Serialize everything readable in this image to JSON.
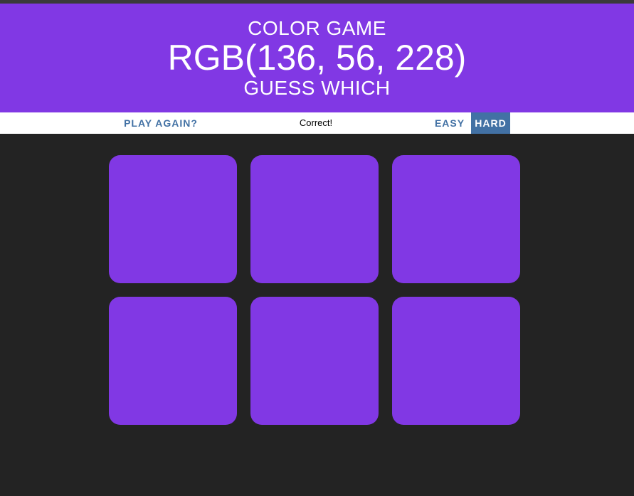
{
  "header": {
    "line1": "COLOR GAME",
    "rgb_display": "RGB(136, 56, 228)",
    "line3": "GUESS WHICH"
  },
  "controls": {
    "play_again_label": "PLAY AGAIN?",
    "message": "Correct!",
    "easy_label": "EASY",
    "hard_label": "HARD",
    "selected_mode": "HARD"
  },
  "colors": {
    "header_bg": "#8138e4",
    "page_bg": "#232323",
    "accent": "#4271a4",
    "squares": [
      "#8138e4",
      "#8138e4",
      "#8138e4",
      "#8138e4",
      "#8138e4",
      "#8138e4"
    ]
  }
}
